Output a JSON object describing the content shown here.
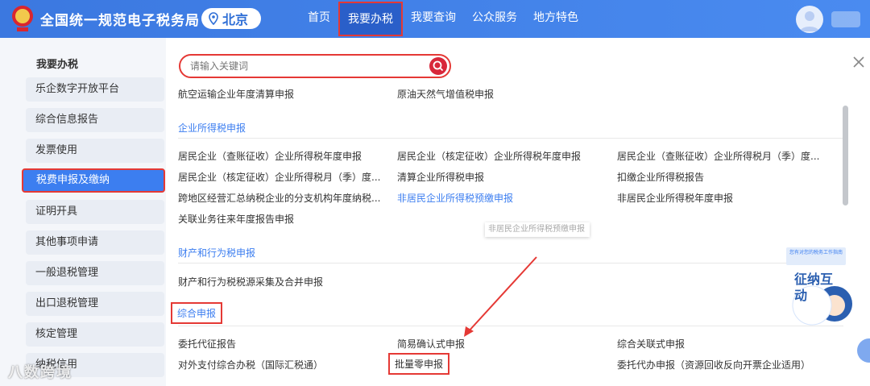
{
  "header": {
    "title": "全国统一规范电子税务局",
    "region": "北京",
    "nav": [
      "首页",
      "我要办税",
      "我要查询",
      "公众服务",
      "地方特色"
    ],
    "active_nav_index": 1
  },
  "sidebar": {
    "title": "我要办税",
    "items": [
      "乐企数字开放平台",
      "综合信息报告",
      "发票使用",
      "税费申报及缴纳",
      "证明开具",
      "其他事项申请",
      "一般退税管理",
      "出口退税管理",
      "核定管理",
      "纳税信用"
    ],
    "active_index": 3
  },
  "search": {
    "placeholder": "请输入关键词"
  },
  "top_row": [
    "航空运输企业年度清算申报",
    "原油天然气增值税申报"
  ],
  "sections": [
    {
      "title": "企业所得税申报",
      "links": [
        "居民企业（查账征收）企业所得税年度申报",
        "居民企业（核定征收）企业所得税年度申报",
        "居民企业（查账征收）企业所得税月（季）度...",
        "居民企业（核定征收）企业所得税月（季）度...",
        "清算企业所得税申报",
        "扣缴企业所得税报告",
        "跨地区经营汇总纳税企业的分支机构年度纳税...",
        "非居民企业所得税预缴申报",
        "非居民企业所得税年度申报",
        "关联业务往来年度报告申报"
      ]
    },
    {
      "title": "财产和行为税申报",
      "links": [
        "财产和行为税税源采集及合并申报"
      ]
    },
    {
      "title": "综合申报",
      "links": [
        "委托代征报告",
        "简易确认式申报",
        "综合关联式申报",
        "对外支付综合办税（国际汇税通）",
        "批量零申报",
        "委托代办申报（资源回收反向开票企业适用）"
      ]
    }
  ],
  "tooltip": "非居民企业所得税预缴申报",
  "mascot": {
    "label": "征纳互动",
    "tip": "您有对您的税务工作指南"
  },
  "watermark": "八数跨境",
  "colors": {
    "header": "#3b78e0",
    "accent": "#3c7ef0",
    "highlight": "#e53935"
  }
}
